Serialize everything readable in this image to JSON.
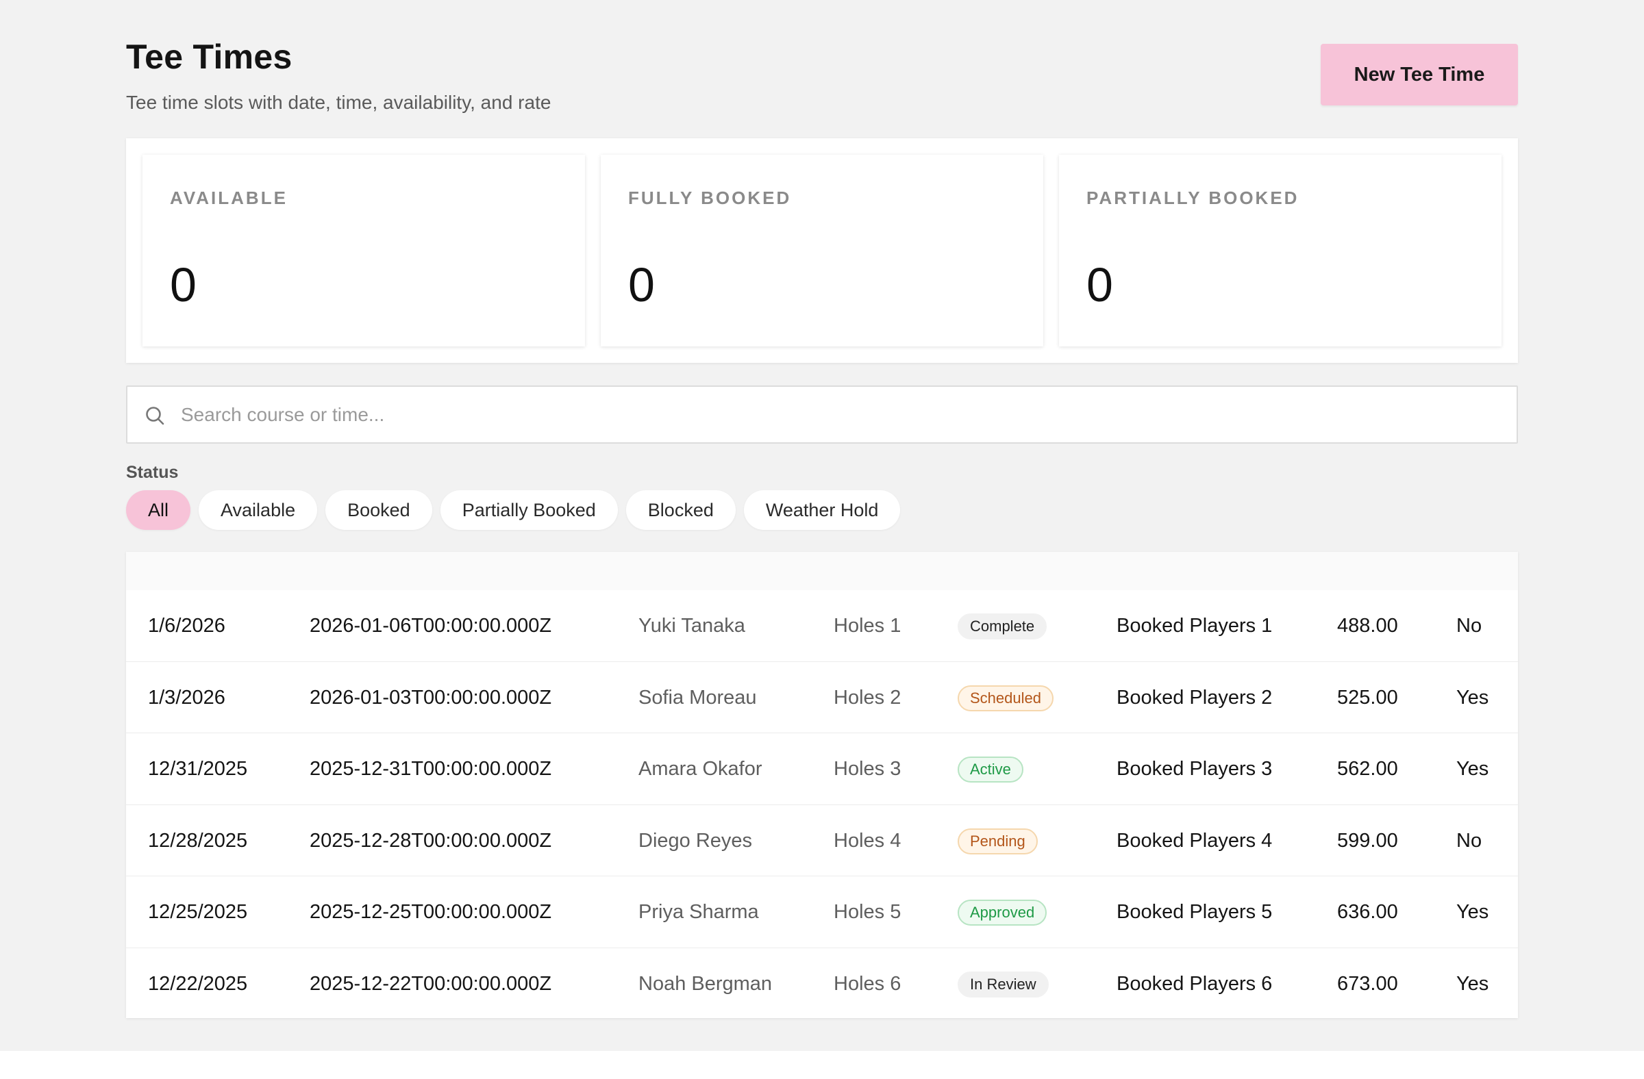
{
  "header": {
    "title": "Tee Times",
    "subtitle": "Tee time slots with date, time, availability, and rate",
    "new_button_label": "New Tee Time"
  },
  "stats": [
    {
      "label": "AVAILABLE",
      "value": "0"
    },
    {
      "label": "FULLY BOOKED",
      "value": "0"
    },
    {
      "label": "PARTIALLY BOOKED",
      "value": "0"
    }
  ],
  "search": {
    "placeholder": "Search course or time...",
    "value": "",
    "icon": "search-icon"
  },
  "filters": {
    "label": "Status",
    "chips": [
      "All",
      "Available",
      "Booked",
      "Partially Booked",
      "Blocked",
      "Weather Hold"
    ],
    "active": "All"
  },
  "table": {
    "rows": [
      {
        "date": "1/6/2026",
        "iso": "2026-01-06T00:00:00.000Z",
        "name": "Yuki Tanaka",
        "holes": "Holes 1",
        "status": "Complete",
        "status_tone": "neutral",
        "players": "Booked Players 1",
        "rate": "488.00",
        "flag": "No"
      },
      {
        "date": "1/3/2026",
        "iso": "2026-01-03T00:00:00.000Z",
        "name": "Sofia Moreau",
        "holes": "Holes 2",
        "status": "Scheduled",
        "status_tone": "warn",
        "players": "Booked Players 2",
        "rate": "525.00",
        "flag": "Yes"
      },
      {
        "date": "12/31/2025",
        "iso": "2025-12-31T00:00:00.000Z",
        "name": "Amara Okafor",
        "holes": "Holes 3",
        "status": "Active",
        "status_tone": "success",
        "players": "Booked Players 3",
        "rate": "562.00",
        "flag": "Yes"
      },
      {
        "date": "12/28/2025",
        "iso": "2025-12-28T00:00:00.000Z",
        "name": "Diego Reyes",
        "holes": "Holes 4",
        "status": "Pending",
        "status_tone": "warn",
        "players": "Booked Players 4",
        "rate": "599.00",
        "flag": "No"
      },
      {
        "date": "12/25/2025",
        "iso": "2025-12-25T00:00:00.000Z",
        "name": "Priya Sharma",
        "holes": "Holes 5",
        "status": "Approved",
        "status_tone": "success",
        "players": "Booked Players 5",
        "rate": "636.00",
        "flag": "Yes"
      },
      {
        "date": "12/22/2025",
        "iso": "2025-12-22T00:00:00.000Z",
        "name": "Noah Bergman",
        "holes": "Holes 6",
        "status": "In Review",
        "status_tone": "neutral",
        "players": "Booked Players 6",
        "rate": "673.00",
        "flag": "Yes"
      }
    ]
  },
  "colors": {
    "accent": "#f7c3d8",
    "background": "#f2f2f2",
    "badge_warn_text": "#b3561a",
    "badge_success_text": "#1e9a46"
  }
}
